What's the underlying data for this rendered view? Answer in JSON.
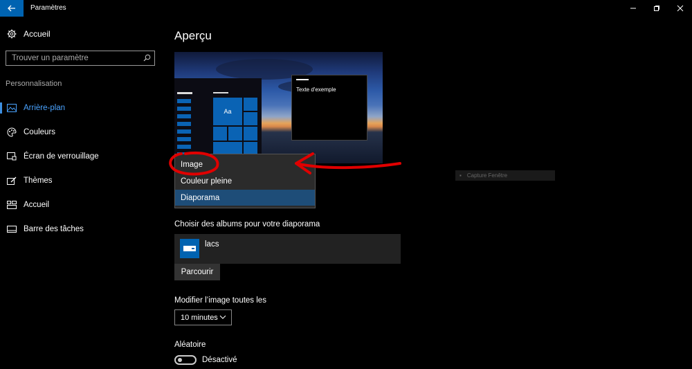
{
  "window": {
    "title": "Paramètres"
  },
  "sidebar": {
    "home_label": "Accueil",
    "search_placeholder": "Trouver un paramètre",
    "section": "Personnalisation",
    "items": [
      {
        "label": "Arrière-plan",
        "icon": "image-icon",
        "active": true
      },
      {
        "label": "Couleurs",
        "icon": "palette-icon"
      },
      {
        "label": "Écran de verrouillage",
        "icon": "lock-screen-icon"
      },
      {
        "label": "Thèmes",
        "icon": "themes-icon"
      },
      {
        "label": "Accueil",
        "icon": "start-icon"
      },
      {
        "label": "Barre des tâches",
        "icon": "taskbar-icon"
      }
    ]
  },
  "main": {
    "title": "Aperçu",
    "preview": {
      "sample_text": "Texte d'exemple",
      "tile_text": "Aa"
    },
    "background_dropdown": {
      "options": [
        "Image",
        "Couleur pleine",
        "Diaporama"
      ],
      "selected": "Diaporama"
    },
    "albums": {
      "label": "Choisir des albums pour votre diaporama",
      "album_name": "lacs",
      "browse_label": "Parcourir"
    },
    "interval": {
      "label": "Modifier l’image toutes les",
      "value": "10 minutes"
    },
    "shuffle": {
      "label": "Aléatoire",
      "state": "Désactivé"
    }
  },
  "ghost_tooltip": "Capture Fenêtre",
  "colors": {
    "accent": "#0063b1",
    "selected": "#1e4d78",
    "annotation": "#e00000"
  }
}
